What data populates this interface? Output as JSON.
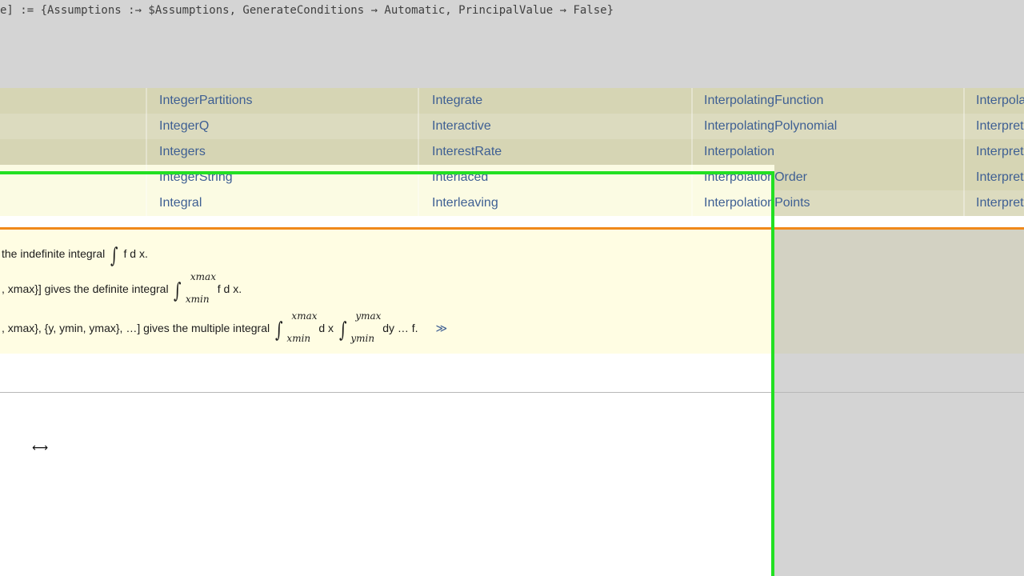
{
  "options_line": "e] := {Assumptions :→ $Assumptions, GenerateConditions → Automatic, PrincipalValue → False}",
  "names_grid": {
    "columns": [
      [
        "IntegerPartitions",
        "IntegerQ",
        "Integers",
        "IntegerString",
        "Integral"
      ],
      [
        "Integrate",
        "Interactive",
        "InterestRate",
        "Interlaced",
        "Interleaving"
      ],
      [
        "InterpolatingFunction",
        "InterpolatingPolynomial",
        "Interpolation",
        "InterpolationOrder",
        "InterpolationPoints"
      ],
      [
        "Interpola",
        "Interpret",
        "Interpret",
        "Interpret",
        "Interpret"
      ]
    ]
  },
  "usage": {
    "line1_text": "the indefinite integral",
    "line1_expr": "f d x.",
    "line2_prefix": ", xmax}] gives the definite integral",
    "line2_upper": "xmax",
    "line2_lower": "xmin",
    "line2_expr": "f d x.",
    "line3_prefix": ", xmax}, {y, ymin, ymax}, …] gives the multiple integral",
    "line3_upper1": "xmax",
    "line3_lower1": "xmin",
    "line3_mid": "d x",
    "line3_upper2": "ymax",
    "line3_lower2": "ymin",
    "line3_expr": "dy … f.",
    "more_link": "≫"
  },
  "cursor_icon": "horizontal-resize-icon",
  "colors": {
    "selection_green": "#22e022",
    "usage_orange": "#f0891a",
    "link_blue": "#3e5f93"
  }
}
